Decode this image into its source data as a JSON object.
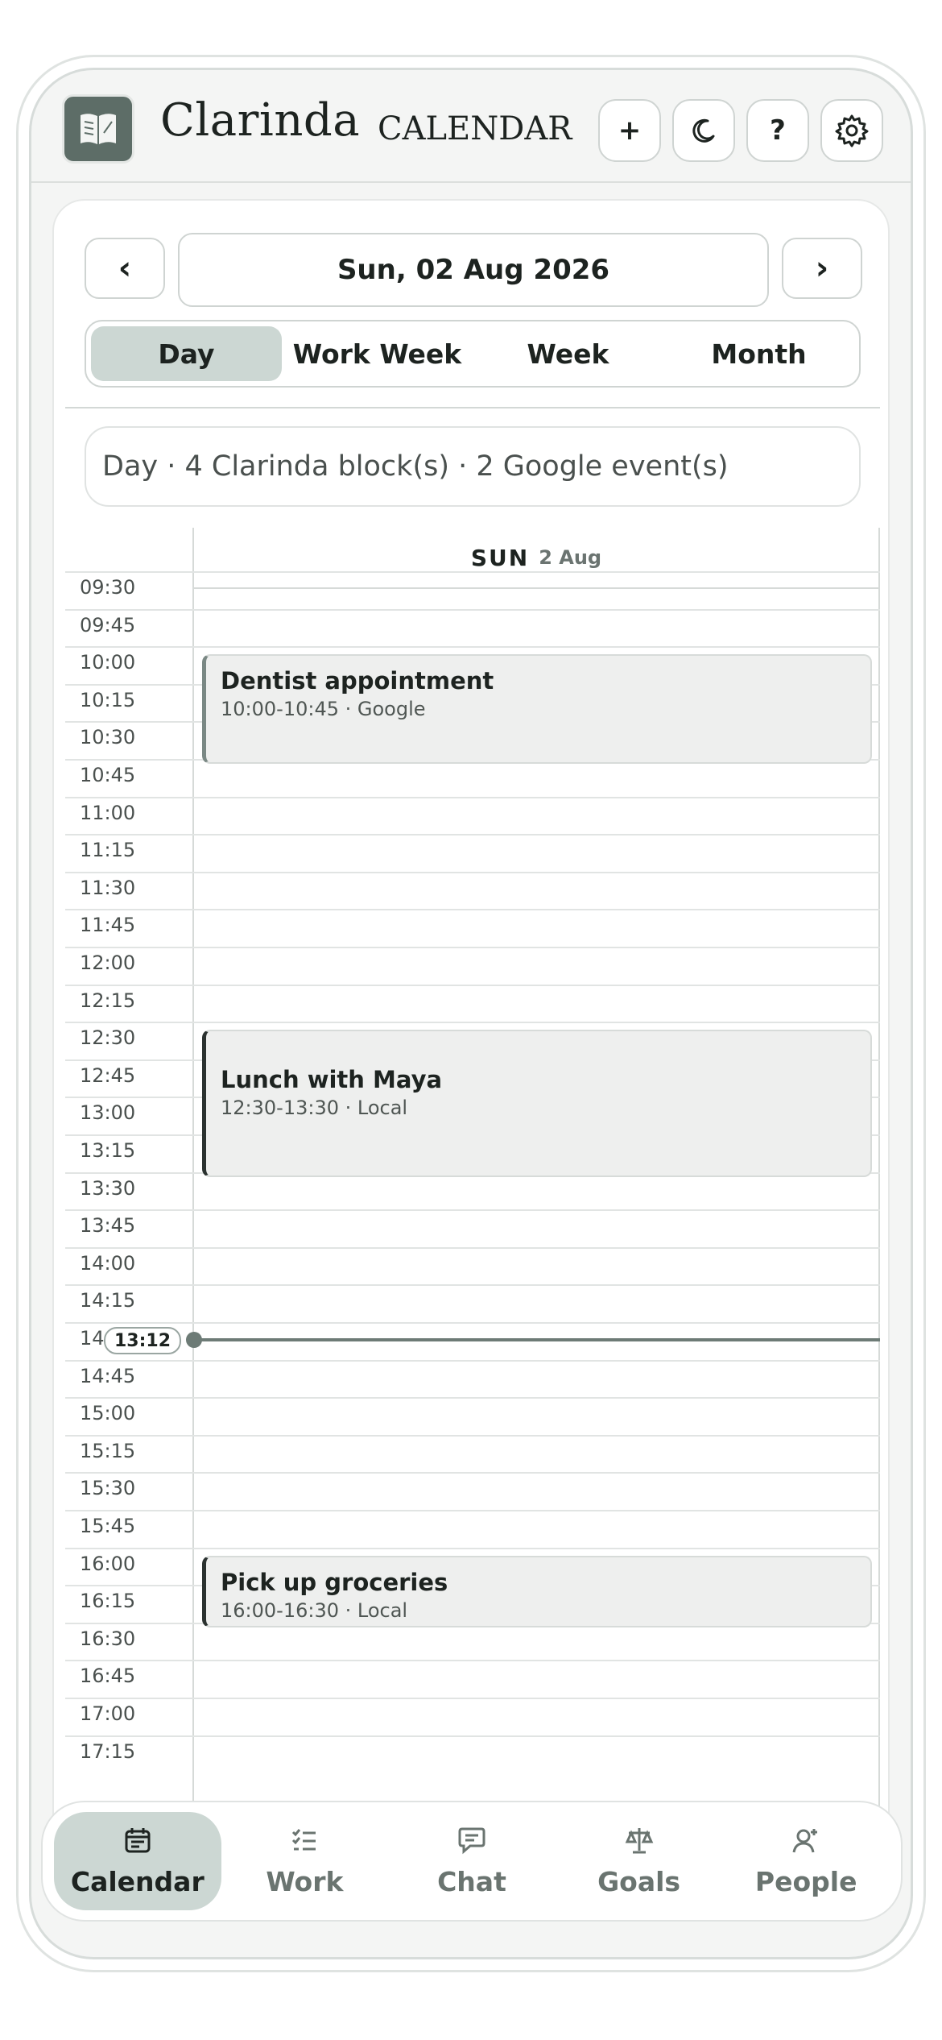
{
  "app": {
    "name": "Clarinda",
    "section_title": "CALENDAR"
  },
  "header_buttons": [
    {
      "name": "add-button",
      "label": "+",
      "icon": "plus-icon"
    },
    {
      "name": "theme-toggle-button",
      "label": "",
      "icon": "moon-icon"
    },
    {
      "name": "help-button",
      "label": "?",
      "icon": "question-icon"
    },
    {
      "name": "settings-button",
      "label": "",
      "icon": "gear-icon"
    }
  ],
  "date_nav": {
    "prev_label": "‹",
    "next_label": "›",
    "current_date": "Sun, 02 Aug 2026"
  },
  "view_tabs": [
    {
      "label": "Day",
      "active": true
    },
    {
      "label": "Work Week",
      "active": false
    },
    {
      "label": "Week",
      "active": false
    },
    {
      "label": "Month",
      "active": false
    }
  ],
  "summary": "Day · 4 Clarinda block(s) · 2 Google event(s)",
  "day_header": {
    "weekday": "SUN",
    "date": "2 Aug"
  },
  "time_slots": [
    "09:30",
    "09:45",
    "10:00",
    "10:15",
    "10:30",
    "10:45",
    "11:00",
    "11:15",
    "11:30",
    "11:45",
    "12:00",
    "12:15",
    "12:30",
    "12:45",
    "13:00",
    "13:15",
    "13:30",
    "13:45",
    "14:00",
    "14:15",
    "14:30",
    "14:45",
    "15:00",
    "15:15",
    "15:30",
    "15:45",
    "16:00",
    "16:15",
    "16:30",
    "16:45",
    "17:00",
    "17:15"
  ],
  "events": [
    {
      "title": "Dentist appointment",
      "meta": "10:00-10:45 · Google",
      "start": "10:00",
      "end": "10:45",
      "source": "google"
    },
    {
      "title": "Lunch with Maya",
      "meta": "12:30-13:30 · Local",
      "start": "12:30",
      "end": "13:30",
      "source": "local"
    },
    {
      "title": "Pick up groceries",
      "meta": "16:00-16:30 · Local",
      "start": "16:00",
      "end": "16:30",
      "source": "local"
    }
  ],
  "current_time": "13:12",
  "bottom_tabs": [
    {
      "label": "Calendar",
      "icon": "calendar-icon",
      "active": true
    },
    {
      "label": "Work",
      "icon": "checklist-icon",
      "active": false
    },
    {
      "label": "Chat",
      "icon": "chat-icon",
      "active": false
    },
    {
      "label": "Goals",
      "icon": "scale-icon",
      "active": false
    },
    {
      "label": "People",
      "icon": "person-add-icon",
      "active": false
    }
  ],
  "colors": {
    "accent": "#5d6d67",
    "active_tab_bg": "#ccd7d3",
    "now_line": "#6d7b76"
  }
}
